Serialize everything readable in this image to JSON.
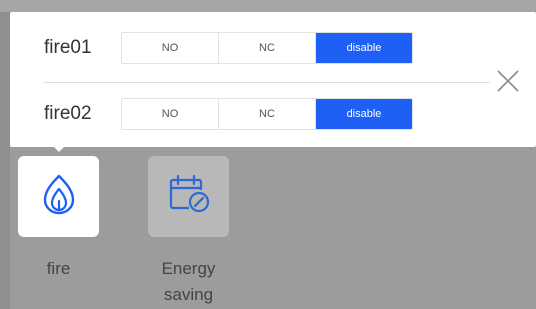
{
  "popup": {
    "rows": [
      {
        "label": "fire01",
        "options": [
          "NO",
          "NC",
          "disable"
        ],
        "selected": "disable"
      },
      {
        "label": "fire02",
        "options": [
          "NO",
          "NC",
          "disable"
        ],
        "selected": "disable"
      }
    ],
    "close_icon": "close-icon"
  },
  "tiles": {
    "fire": {
      "label": "fire",
      "icon": "flame-icon",
      "selected": true
    },
    "energy": {
      "label_line1": "Energy",
      "label_line2": "saving",
      "icon": "calendar-leaf-icon",
      "selected": false
    }
  },
  "colors": {
    "accent": "#1e5ff5",
    "overlay": "#9c9c9c",
    "tile_selected_bg": "#ffffff",
    "tile_bg": "#b8b8b8"
  }
}
